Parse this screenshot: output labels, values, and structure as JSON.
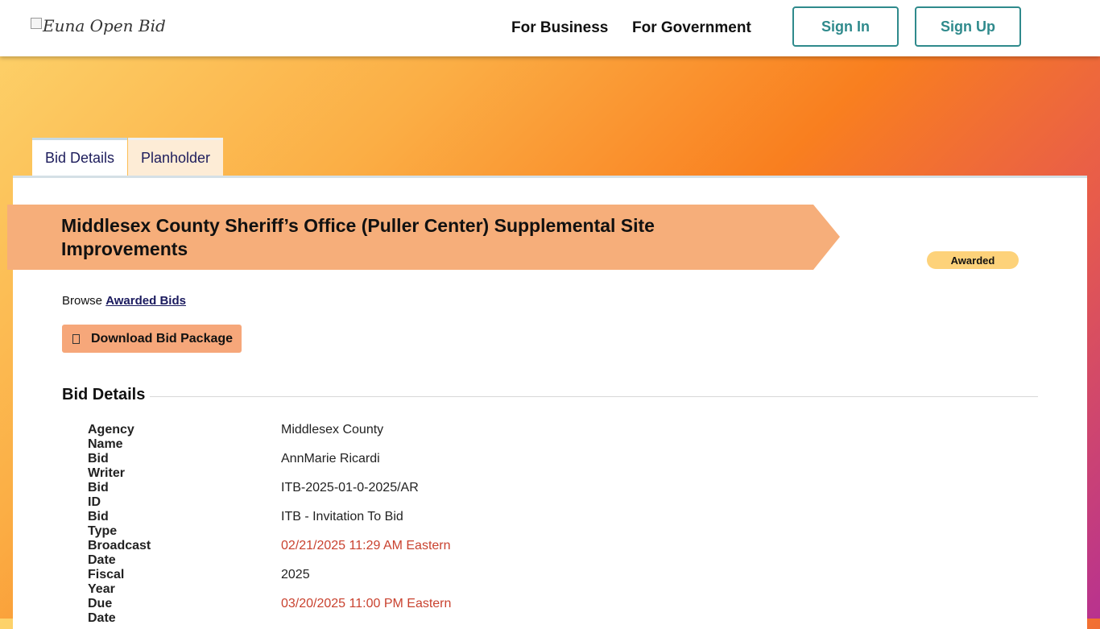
{
  "header": {
    "logo_alt": "Euna Open Bid",
    "nav": {
      "business": "For Business",
      "government": "For Government"
    },
    "sign_in": "Sign In",
    "sign_up": "Sign Up"
  },
  "tabs": {
    "bid_details": "Bid Details",
    "planholder": "Planholder"
  },
  "bid": {
    "title": "Middlesex County Sheriff’s Office (Puller Center) Supplemental Site Improvements",
    "status": "Awarded",
    "browse_prefix": "Browse",
    "browse_link": "Awarded Bids",
    "download_label": "Download Bid Package"
  },
  "section": {
    "title": "Bid Details"
  },
  "details": [
    {
      "label": "Agency Name",
      "value": "Middlesex County"
    },
    {
      "label": "Bid Writer",
      "value": "AnnMarie Ricardi"
    },
    {
      "label": "Bid ID",
      "value": "ITB-2025-01-0-2025/AR"
    },
    {
      "label": "Bid Type",
      "value": "ITB - Invitation To Bid"
    },
    {
      "label": "Broadcast Date",
      "value": "02/21/2025 11:29 AM Eastern"
    },
    {
      "label": "Fiscal Year",
      "value": "2025"
    },
    {
      "label": "Due Date",
      "value": "03/20/2025 11:00 PM Eastern"
    }
  ],
  "colors": {
    "accent_teal": "#2f8a8c",
    "banner": "#f6ae7a",
    "badge": "#fdd27a",
    "date_red": "#c9422f"
  }
}
